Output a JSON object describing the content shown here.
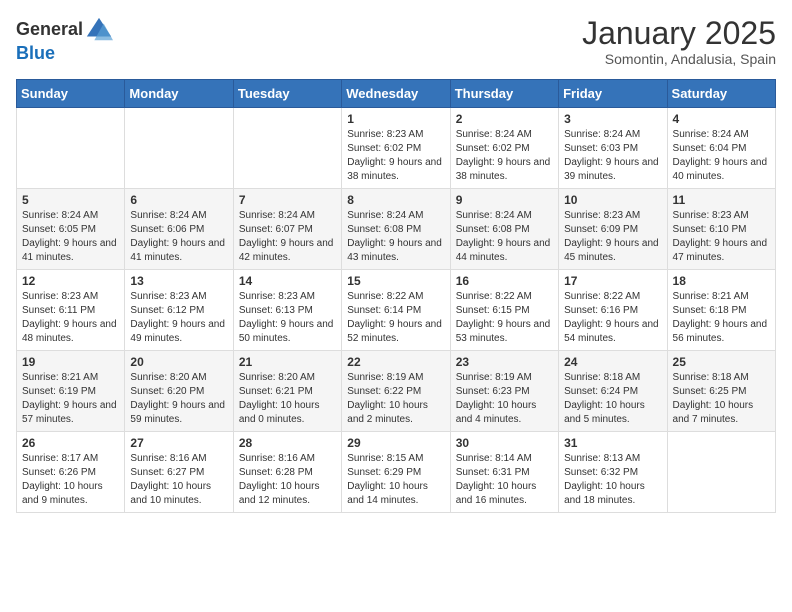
{
  "header": {
    "logo_general": "General",
    "logo_blue": "Blue",
    "month_title": "January 2025",
    "location": "Somontin, Andalusia, Spain"
  },
  "calendar": {
    "days_of_week": [
      "Sunday",
      "Monday",
      "Tuesday",
      "Wednesday",
      "Thursday",
      "Friday",
      "Saturday"
    ],
    "weeks": [
      [
        {
          "day": "",
          "info": ""
        },
        {
          "day": "",
          "info": ""
        },
        {
          "day": "",
          "info": ""
        },
        {
          "day": "1",
          "info": "Sunrise: 8:23 AM\nSunset: 6:02 PM\nDaylight: 9 hours and 38 minutes."
        },
        {
          "day": "2",
          "info": "Sunrise: 8:24 AM\nSunset: 6:02 PM\nDaylight: 9 hours and 38 minutes."
        },
        {
          "day": "3",
          "info": "Sunrise: 8:24 AM\nSunset: 6:03 PM\nDaylight: 9 hours and 39 minutes."
        },
        {
          "day": "4",
          "info": "Sunrise: 8:24 AM\nSunset: 6:04 PM\nDaylight: 9 hours and 40 minutes."
        }
      ],
      [
        {
          "day": "5",
          "info": "Sunrise: 8:24 AM\nSunset: 6:05 PM\nDaylight: 9 hours and 41 minutes."
        },
        {
          "day": "6",
          "info": "Sunrise: 8:24 AM\nSunset: 6:06 PM\nDaylight: 9 hours and 41 minutes."
        },
        {
          "day": "7",
          "info": "Sunrise: 8:24 AM\nSunset: 6:07 PM\nDaylight: 9 hours and 42 minutes."
        },
        {
          "day": "8",
          "info": "Sunrise: 8:24 AM\nSunset: 6:08 PM\nDaylight: 9 hours and 43 minutes."
        },
        {
          "day": "9",
          "info": "Sunrise: 8:24 AM\nSunset: 6:08 PM\nDaylight: 9 hours and 44 minutes."
        },
        {
          "day": "10",
          "info": "Sunrise: 8:23 AM\nSunset: 6:09 PM\nDaylight: 9 hours and 45 minutes."
        },
        {
          "day": "11",
          "info": "Sunrise: 8:23 AM\nSunset: 6:10 PM\nDaylight: 9 hours and 47 minutes."
        }
      ],
      [
        {
          "day": "12",
          "info": "Sunrise: 8:23 AM\nSunset: 6:11 PM\nDaylight: 9 hours and 48 minutes."
        },
        {
          "day": "13",
          "info": "Sunrise: 8:23 AM\nSunset: 6:12 PM\nDaylight: 9 hours and 49 minutes."
        },
        {
          "day": "14",
          "info": "Sunrise: 8:23 AM\nSunset: 6:13 PM\nDaylight: 9 hours and 50 minutes."
        },
        {
          "day": "15",
          "info": "Sunrise: 8:22 AM\nSunset: 6:14 PM\nDaylight: 9 hours and 52 minutes."
        },
        {
          "day": "16",
          "info": "Sunrise: 8:22 AM\nSunset: 6:15 PM\nDaylight: 9 hours and 53 minutes."
        },
        {
          "day": "17",
          "info": "Sunrise: 8:22 AM\nSunset: 6:16 PM\nDaylight: 9 hours and 54 minutes."
        },
        {
          "day": "18",
          "info": "Sunrise: 8:21 AM\nSunset: 6:18 PM\nDaylight: 9 hours and 56 minutes."
        }
      ],
      [
        {
          "day": "19",
          "info": "Sunrise: 8:21 AM\nSunset: 6:19 PM\nDaylight: 9 hours and 57 minutes."
        },
        {
          "day": "20",
          "info": "Sunrise: 8:20 AM\nSunset: 6:20 PM\nDaylight: 9 hours and 59 minutes."
        },
        {
          "day": "21",
          "info": "Sunrise: 8:20 AM\nSunset: 6:21 PM\nDaylight: 10 hours and 0 minutes."
        },
        {
          "day": "22",
          "info": "Sunrise: 8:19 AM\nSunset: 6:22 PM\nDaylight: 10 hours and 2 minutes."
        },
        {
          "day": "23",
          "info": "Sunrise: 8:19 AM\nSunset: 6:23 PM\nDaylight: 10 hours and 4 minutes."
        },
        {
          "day": "24",
          "info": "Sunrise: 8:18 AM\nSunset: 6:24 PM\nDaylight: 10 hours and 5 minutes."
        },
        {
          "day": "25",
          "info": "Sunrise: 8:18 AM\nSunset: 6:25 PM\nDaylight: 10 hours and 7 minutes."
        }
      ],
      [
        {
          "day": "26",
          "info": "Sunrise: 8:17 AM\nSunset: 6:26 PM\nDaylight: 10 hours and 9 minutes."
        },
        {
          "day": "27",
          "info": "Sunrise: 8:16 AM\nSunset: 6:27 PM\nDaylight: 10 hours and 10 minutes."
        },
        {
          "day": "28",
          "info": "Sunrise: 8:16 AM\nSunset: 6:28 PM\nDaylight: 10 hours and 12 minutes."
        },
        {
          "day": "29",
          "info": "Sunrise: 8:15 AM\nSunset: 6:29 PM\nDaylight: 10 hours and 14 minutes."
        },
        {
          "day": "30",
          "info": "Sunrise: 8:14 AM\nSunset: 6:31 PM\nDaylight: 10 hours and 16 minutes."
        },
        {
          "day": "31",
          "info": "Sunrise: 8:13 AM\nSunset: 6:32 PM\nDaylight: 10 hours and 18 minutes."
        },
        {
          "day": "",
          "info": ""
        }
      ]
    ]
  }
}
